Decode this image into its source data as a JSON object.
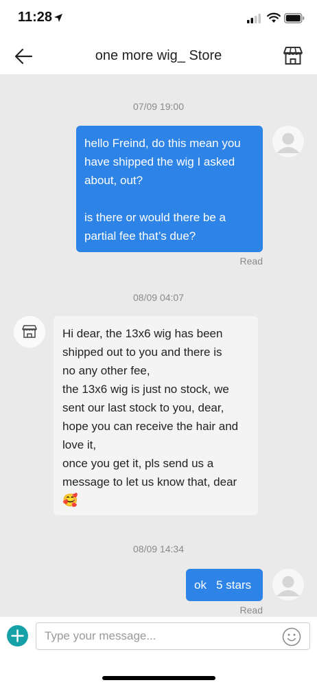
{
  "status_bar": {
    "time": "11:28"
  },
  "header": {
    "title": "one more wig_ Store"
  },
  "messages": [
    {
      "timestamp": "07/09 19:00",
      "lines": [
        "hello Freind, do this mean you",
        "have shipped the wig I asked",
        "about, out?",
        "",
        "is there  or would there be a",
        "partial fee that’s due?"
      ],
      "status": "Read"
    },
    {
      "timestamp": "08/09 04:07",
      "lines": [
        "Hi dear, the 13x6 wig has been",
        "shipped out to you and there is",
        "no any other fee,",
        "the 13x6 wig is just no stock, we",
        "sent our last stock to you, dear,",
        "hope you can receive the hair and",
        "love it,",
        "once you get it, pls send us a",
        "message to let us know that, dear"
      ],
      "emoji": "🥰"
    },
    {
      "timestamp": "08/09 14:34",
      "text": "ok   5 stars",
      "status": "Read"
    }
  ],
  "composer": {
    "placeholder": "Type your message..."
  },
  "icons": {
    "back": "arrow-left-icon",
    "store": "store-icon",
    "avatar_user": "user-avatar-icon",
    "avatar_store": "store-avatar-icon",
    "add": "plus-icon",
    "emoji": "smiley-icon"
  },
  "colors": {
    "outgoing_bubble": "#2d83e6",
    "incoming_bubble": "#f4f4f4",
    "chat_background": "#eaeaea",
    "add_button": "#16a0a8"
  }
}
